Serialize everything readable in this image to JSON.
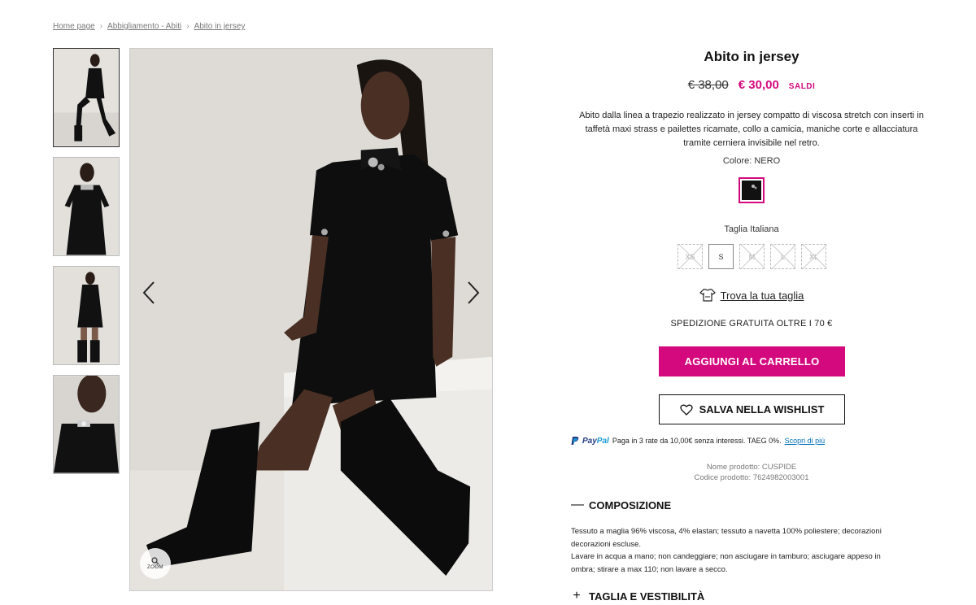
{
  "breadcrumb": {
    "items": [
      "Home page",
      "Abbigliamento - Abiti",
      "Abito in jersey"
    ]
  },
  "gallery": {
    "zoom_label": "ZOOM"
  },
  "product": {
    "title": "Abito in jersey",
    "price_old": "€ 38,00",
    "price_new": "€ 30,00",
    "sale_label": "SALDI",
    "description": "Abito dalla linea a trapezio realizzato in jersey compatto di viscosa stretch con inserti in taffetà maxi strass e pailettes ricamate, collo a camicia, maniche corte e allacciatura tramite cerniera invisibile nel retro.",
    "color_label": "Colore: NERO",
    "size_label": "Taglia Italiana",
    "sizes": [
      "XS",
      "S",
      "M",
      "L",
      "XL"
    ],
    "find_size": "Trova la tua taglia",
    "shipping": "SPEDIZIONE GRATUITA OLTRE I 70 €",
    "add_to_cart": "AGGIUNGI AL CARRELLO",
    "wishlist": "SALVA NELLA WISHLIST",
    "paypal_pay": "Pay",
    "paypal_pal": "Pal",
    "paypal_text": "Paga in 3 rate da 10,00€ senza interessi. TAEG 0%.",
    "paypal_link": "Scopri di più",
    "product_name": "Nome prodotto: CUSPIDE",
    "product_code": "Codice prodotto:  7624982003001"
  },
  "accordion": {
    "composition_title": "COMPOSIZIONE",
    "composition_text_1": "Tessuto a maglia 96% viscosa, 4% elastan; tessuto a navetta 100% poliestere; decorazioni",
    "composition_text_2": "decorazioni escluse.",
    "care_text_1": "Lavare in acqua a mano; non candeggiare; non asciugare in tamburo; asciugare appeso in",
    "care_text_2": "ombra; stirare a max 110; non lavare a secco.",
    "size_fit_title": "TAGLIA E VESTIBILITÀ"
  },
  "colors": {
    "accent": "#d4097d"
  }
}
